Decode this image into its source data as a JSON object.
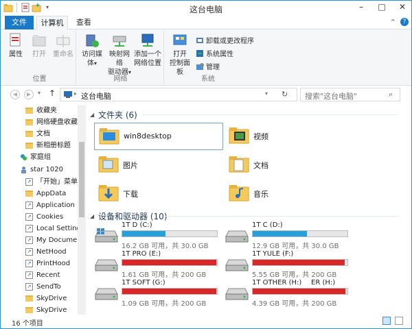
{
  "window": {
    "title": "这台电脑"
  },
  "tabs": {
    "file": "文件",
    "computer": "计算机",
    "view": "查看"
  },
  "ribbon": {
    "groups": {
      "location": "位置",
      "network": "网络",
      "system": "系统"
    },
    "properties": "属性",
    "open": "打开",
    "rename": "重命名",
    "access_media": "访问媒体",
    "map_drive_1": "映射网络",
    "map_drive_2": "驱动器",
    "add_location_1": "添加一个",
    "add_location_2": "网络位置",
    "open_cp_1": "打开",
    "open_cp_2": "控制面板",
    "uninstall": "卸载或更改程序",
    "sys_props": "系统属性",
    "manage": "管理"
  },
  "address": {
    "path": "这台电脑",
    "search_placeholder": "搜索\"这台电脑\""
  },
  "sidebar": {
    "items": [
      {
        "label": "收藏夹",
        "icon": "folder-icon"
      },
      {
        "label": "网络硬盘收藏夹",
        "icon": "folder-icon"
      },
      {
        "label": "文档",
        "icon": "folder-icon"
      },
      {
        "label": "新相册标题",
        "icon": "folder-icon"
      },
      {
        "label": "家庭组",
        "icon": "homegroup-icon"
      },
      {
        "label": "star 1020",
        "icon": "user-icon"
      },
      {
        "label": "「开始」菜单",
        "icon": "shortcut-icon"
      },
      {
        "label": "AppData",
        "icon": "folder-icon"
      },
      {
        "label": "Application D",
        "icon": "shortcut-icon"
      },
      {
        "label": "Cookies",
        "icon": "shortcut-icon"
      },
      {
        "label": "Local Settings",
        "icon": "shortcut-icon"
      },
      {
        "label": "My Document",
        "icon": "shortcut-icon"
      },
      {
        "label": "NetHood",
        "icon": "shortcut-icon"
      },
      {
        "label": "PrintHood",
        "icon": "shortcut-icon"
      },
      {
        "label": "Recent",
        "icon": "shortcut-icon"
      },
      {
        "label": "SendTo",
        "icon": "shortcut-icon"
      },
      {
        "label": "SkyDrive",
        "icon": "folder-icon"
      },
      {
        "label": "SkyDrive",
        "icon": "folder-icon"
      }
    ]
  },
  "folders": {
    "title": "文件夹 (6)",
    "items": [
      {
        "name": "win8desktop"
      },
      {
        "name": "视频"
      },
      {
        "name": "图片"
      },
      {
        "name": "文档"
      },
      {
        "name": "下载"
      },
      {
        "name": "音乐"
      }
    ]
  },
  "drives": {
    "title": "设备和驱动器 (10)",
    "items": [
      {
        "name": "1T D (C:)",
        "info": "16.2 GB 可用，共 30.0 GB",
        "used": 0.46,
        "color": "#26a0da"
      },
      {
        "name": "1T C (D:)",
        "info": "12.9 GB 可用，共 30.0 GB",
        "used": 0.57,
        "color": "#26a0da"
      },
      {
        "name": "1T PRO (E:)",
        "info": "1.61 GB 可用，共 200 GB",
        "used": 0.99,
        "color": "#da2626"
      },
      {
        "name": "1T YULE (F:)",
        "info": "5.55 GB 可用，共 200 GB",
        "used": 0.97,
        "color": "#da2626"
      },
      {
        "name": "1T SOFT (G:)",
        "info": "1.09 GB 可用，共 200 GB",
        "used": 0.99,
        "color": "#da2626"
      },
      {
        "name": "1T OTHER (H:)",
        "name_overlay": "ER (H:)",
        "info": "4.39 GB 可用，共 200 GB",
        "used": 0.98,
        "color": "#da2626"
      }
    ]
  },
  "status": {
    "count": "16 个项目"
  }
}
